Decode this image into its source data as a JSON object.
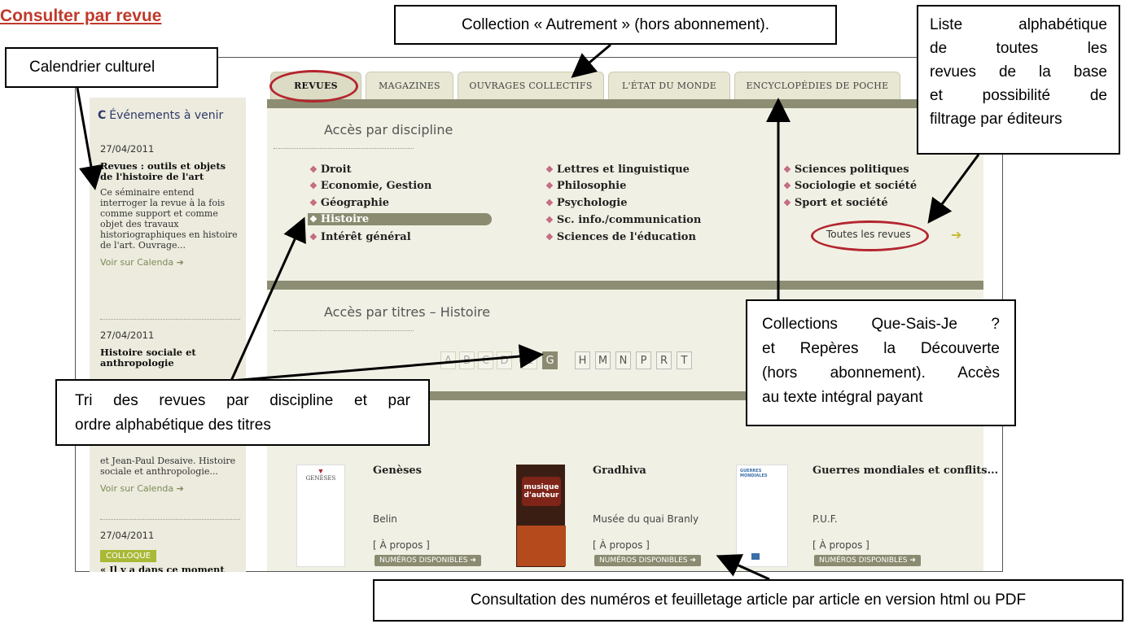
{
  "heading": "Consulter par revue",
  "callouts": {
    "calendrier": "Calendrier culturel",
    "autrement": "Collection « Autrement » (hors abonnement).",
    "liste": [
      "Liste alphabétique",
      "de toutes les",
      "revues de la base",
      "et possibilité de",
      "filtrage par éditeurs"
    ],
    "collections": [
      "Collections Que-Sais-Je ?",
      "et Repères la Découverte",
      "(hors abonnement). Accès",
      "au texte intégral payant"
    ],
    "tri": [
      "Tri des revues par discipline et par",
      "ordre alphabétique des titres"
    ],
    "consultation": "Consultation des numéros et feuilletage article par article en version html ou PDF"
  },
  "sidebar": {
    "title": "Événements à venir",
    "events": [
      {
        "date": "27/04/2011",
        "title": "Revues : outils et objets de l'histoire de l'art",
        "desc": "Ce séminaire entend interroger la revue à la fois comme support et comme objet des travaux historiographiques en histoire de l'art. Ouvrage...",
        "link": "Voir sur Calenda ➔"
      },
      {
        "date": "27/04/2011",
        "title": "Histoire sociale et anthropologie",
        "desc_tail": "et Jean-Paul Desaive. Histoire sociale et anthropologie...",
        "link": "Voir sur Calenda ➔"
      },
      {
        "date": "27/04/2011",
        "badge": "COLLOQUE",
        "title": "« Il y a dans ce moment"
      }
    ]
  },
  "tabs": [
    "REVUES",
    "MAGAZINES",
    "OUVRAGES COLLECTIFS",
    "L'ÉTAT DU MONDE",
    "ENCYCLOPÉDIES DE POCHE"
  ],
  "discipline": {
    "title": "Accès par discipline",
    "col1": [
      "Droit",
      "Economie, Gestion",
      "Géographie",
      "Histoire",
      "Intérêt général"
    ],
    "col2": [
      "Lettres et linguistique",
      "Philosophie",
      "Psychologie",
      "Sc. info./communication",
      "Sciences de l'éducation"
    ],
    "col3": [
      "Sciences politiques",
      "Sociologie et société",
      "Sport et société"
    ],
    "selected": "Histoire",
    "all_link": "Toutes les revues",
    "arrow": "➔"
  },
  "titres": {
    "title": "Accès par titres – Histoire",
    "letters": [
      "A",
      "B",
      "C",
      "D",
      "E",
      "G",
      "H",
      "M",
      "N",
      "P",
      "R",
      "T"
    ],
    "selected": "G"
  },
  "revues": [
    {
      "title": "Genèses",
      "publisher": "Belin",
      "about": "[ À propos ]",
      "button": "NUMÉROS DISPONIBLES ➔",
      "cover_text": "GENÈSES"
    },
    {
      "title": "Gradhiva",
      "publisher": "Musée du quai Branly",
      "about": "[ À propos ]",
      "button": "NUMÉROS DISPONIBLES ➔",
      "cover_text": "musique d'auteur"
    },
    {
      "title": "Guerres mondiales et conflits...",
      "publisher": "P.U.F.",
      "about": "[ À propos ]",
      "button": "NUMÉROS DISPONIBLES ➔",
      "cover_text": "GUERRES MONDIALES"
    }
  ],
  "colors": {
    "accent_red": "#b3262e",
    "bar": "#8c8d73",
    "panel": "#f1f0e4",
    "sidebar": "#ecebde",
    "badge": "#a9b835"
  }
}
